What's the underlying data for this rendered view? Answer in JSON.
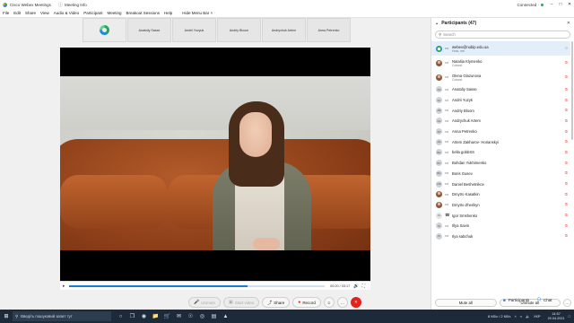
{
  "titlebar": {
    "app_title": "Cisco Webex Meetings",
    "info_label": "Meeting Info",
    "hide_menu_label": "Hide Menu Bar ˄",
    "connection_label": "Connected ·",
    "min": "–",
    "max": "□",
    "close": "✕"
  },
  "menubar": {
    "items": [
      "File",
      "Edit",
      "Share",
      "View",
      "Audio & Video",
      "Participant",
      "Meeting",
      "Breakout Sessions",
      "Help"
    ]
  },
  "thumbnails": [
    "Anatoliy Sasse",
    "Andrii Yuzyuk",
    "Andriy Bloom",
    "Andrychuk Artem",
    "Anna Petrenko"
  ],
  "video": {
    "time": "00:20 / 03:17",
    "progress_fraction": 0.7
  },
  "controls": {
    "unmute": "Unmute",
    "start_video": "Start video",
    "share": "Share",
    "record": "Record",
    "reactions": "☺",
    "more": "…",
    "end": "✕"
  },
  "panel": {
    "title": "Participants (47)",
    "search_placeholder": "Search",
    "participants": [
      {
        "name": "webex@nubip.edu.ua",
        "sub": "Host, me",
        "initials": "",
        "avatar": "self",
        "muted": false
      },
      {
        "name": "Nataliia Klymenko",
        "sub": "Cohost",
        "initials": "",
        "avatar": "photo",
        "muted": true
      },
      {
        "name": "Olena Glazunova",
        "sub": "Cohost",
        "initials": "",
        "avatar": "photo",
        "muted": true
      },
      {
        "name": "Anatoliy Sasse",
        "sub": "",
        "initials": "AS",
        "avatar": "initials",
        "muted": true
      },
      {
        "name": "Andrii Yuzyk",
        "sub": "",
        "initials": "AY",
        "avatar": "initials",
        "muted": true
      },
      {
        "name": "Andriy Bloom",
        "sub": "",
        "initials": "AB",
        "avatar": "initials",
        "muted": true
      },
      {
        "name": "Andrychuk Artem",
        "sub": "",
        "initials": "AA",
        "avatar": "initials",
        "muted": true
      },
      {
        "name": "Anna Petrenko",
        "sub": "",
        "initials": "AP",
        "avatar": "initials",
        "muted": true
      },
      {
        "name": "Artem Zakharov- Horianskyi",
        "sub": "",
        "initials": "AZ",
        "avatar": "initials",
        "muted": true
      },
      {
        "name": "bella gobbSS",
        "sub": "",
        "initials": "BG",
        "avatar": "initials",
        "muted": true
      },
      {
        "name": "Bohdan Yukhimenko",
        "sub": "",
        "initials": "BY",
        "avatar": "initials",
        "muted": true
      },
      {
        "name": "Boris Gusev",
        "sub": "",
        "initials": "BG",
        "avatar": "initials",
        "muted": true
      },
      {
        "name": "Daniel Beshetnikov",
        "sub": "",
        "initials": "DB",
        "avatar": "initials",
        "muted": true
      },
      {
        "name": "Dmytro Kasatkin",
        "sub": "",
        "initials": "",
        "avatar": "photo",
        "muted": true
      },
      {
        "name": "Dmytro Zherikyn",
        "sub": "",
        "initials": "",
        "avatar": "photo",
        "muted": true
      },
      {
        "name": "Igor Smshenko",
        "sub": "",
        "initials": "IS",
        "avatar": "phone",
        "muted": true
      },
      {
        "name": "Illya Savin",
        "sub": "",
        "initials": "IS",
        "avatar": "initials",
        "muted": true
      },
      {
        "name": "Ilya sabchuk",
        "sub": "",
        "initials": "IS",
        "avatar": "initials",
        "muted": true
      }
    ],
    "mute_all": "Mute all",
    "unmute_all": "Unmute all",
    "more": "…"
  },
  "side_buttons": {
    "participants": "Participants",
    "chat": "Chat"
  },
  "taskbar": {
    "search_placeholder": "Введіть пошуковий запит тут",
    "network": "8 Кб/с / 2 Кб/с",
    "lang": "УКР",
    "time": "14:57",
    "date": "29.04.2021"
  },
  "colors": {
    "accent": "#1d7bd8",
    "end_red": "#e2231a",
    "muted_red": "#d8362c",
    "taskbar": "#1c2a3a"
  }
}
